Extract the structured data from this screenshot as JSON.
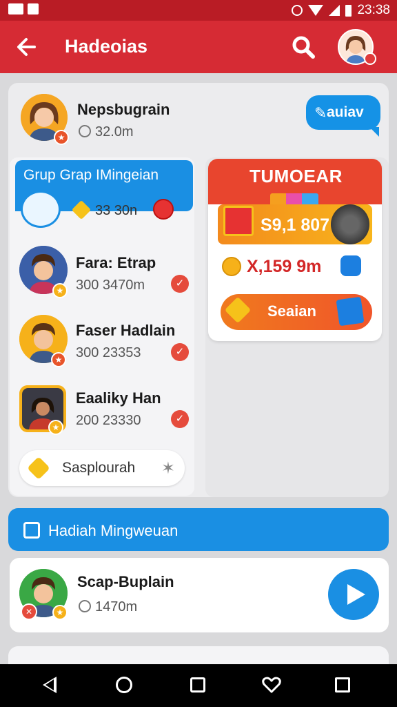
{
  "status_bar": {
    "time": "23:38"
  },
  "app_bar": {
    "title": "Hadeoias"
  },
  "profile": {
    "name": "Nepsbugrain",
    "stat": "32.0m"
  },
  "chat_bubble": {
    "label": "auiav"
  },
  "group": {
    "title": "Grup Grap IMingeian",
    "count": "33 30n",
    "members": [
      {
        "name": "Fara: Etrap",
        "stat": "300 3470m"
      },
      {
        "name": "Faser Hadlain",
        "stat": "300 23353"
      },
      {
        "name": "Eaaliky Han",
        "stat": "200 23330"
      }
    ],
    "suggest_label": "Sasplourah"
  },
  "reward": {
    "title": "TUMOEAR",
    "amount": "S9,1 807",
    "coin_amount": "X,159 9m",
    "session_label": "Seaian"
  },
  "weekly": {
    "label": "Hadiah Mingweuan",
    "item": {
      "name": "Scap-Buplain",
      "stat": "1470m"
    }
  },
  "colors": {
    "primary_red": "#d62b34",
    "status_red": "#b91c25",
    "accent_blue": "#1a8fe3",
    "reward_orange": "#e8452e",
    "gold": "#f6b11a"
  },
  "icons": {
    "app_bar": [
      "back-arrow-icon",
      "search-icon"
    ],
    "nav": [
      "back-icon",
      "home-icon",
      "recents-icon",
      "heart-icon",
      "square-icon"
    ]
  }
}
